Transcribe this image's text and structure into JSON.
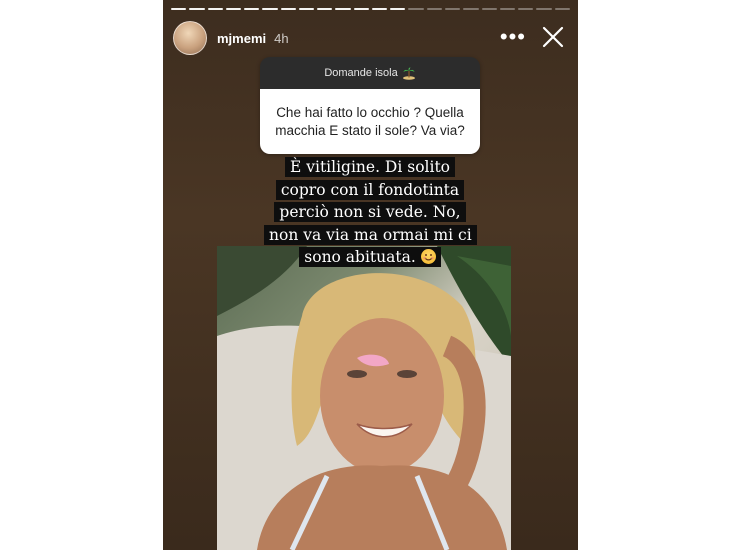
{
  "story": {
    "username": "mjmemi",
    "time": "4h",
    "progress_total": 22,
    "progress_done": 13
  },
  "question_sticker": {
    "title": "Domande isola",
    "title_icon": "island-icon",
    "question": "Che hai fatto lo occhio ? Quella macchia E stato il sole? Va via?"
  },
  "answer": {
    "text": "È vitiligine. Di solito copro con il fondotinta perciò non si vede. No, non va via ma ormai mi ci sono abituata.",
    "emoji": "smiling-face-emoji"
  },
  "icons": {
    "more": "more-options-icon",
    "close": "close-icon"
  },
  "colors": {
    "sticker_header": "#2c2c2c",
    "text_highlight": "#0e0e0e",
    "story_background": "#3d2d1f"
  }
}
